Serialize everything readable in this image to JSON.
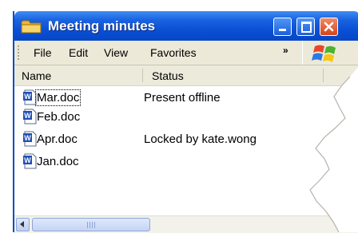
{
  "window": {
    "title": "Meeting minutes",
    "title_icon": "folder-icon",
    "controls": [
      "minimize-icon",
      "maximize-icon",
      "close-icon"
    ]
  },
  "menubar": {
    "items": [
      "File",
      "Edit",
      "View",
      "Favorites"
    ],
    "overflow_icon": "chevron-double-right-icon",
    "logo": "windows-logo-icon"
  },
  "columns": {
    "name": "Name",
    "status": "Status"
  },
  "files": [
    {
      "name": "Mar.doc",
      "status": "Present offline",
      "icon": "word-document-icon",
      "focused": true
    },
    {
      "name": "Feb.doc",
      "status": "",
      "icon": "word-document-icon"
    },
    {
      "name": "Apr.doc",
      "status": "Locked by kate.wong",
      "icon": "word-document-icon"
    },
    {
      "name": "Jan.doc",
      "status": "",
      "icon": "word-document-icon"
    }
  ],
  "colors": {
    "titlebar": "#0a4fd4",
    "menubar": "#ece9d8",
    "close_button": "#d4441c"
  }
}
